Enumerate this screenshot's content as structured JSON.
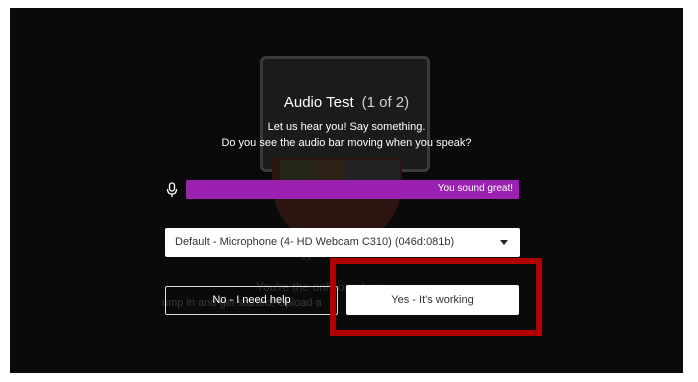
{
  "background": {
    "overlay_text_1": "W",
    "overlay_text_2": "You're the only one here",
    "overlay_text_3": "ump in and get started! Upload a"
  },
  "dialog": {
    "title": "Audio Test",
    "step": "(1 of 2)",
    "subtitle_line1": "Let us hear you! Say something.",
    "subtitle_line2": "Do you see the audio bar moving when you speak?",
    "mic_icon": "microphone-icon",
    "audio_bar": {
      "message": "You sound great!",
      "color": "#9b22b0"
    },
    "device_select": {
      "selected": "Default - Microphone (4- HD Webcam C310) (046d:081b)"
    },
    "buttons": {
      "no_label": "No - I need help",
      "yes_label": "Yes - It's working"
    },
    "highlight_color": "#b00000"
  }
}
